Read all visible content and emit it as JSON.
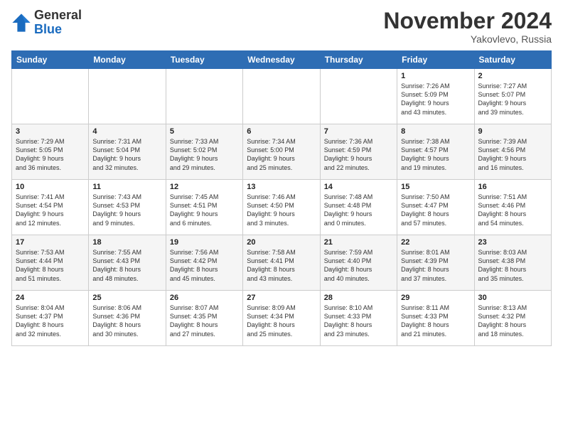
{
  "logo": {
    "line1": "General",
    "line2": "Blue"
  },
  "title": "November 2024",
  "location": "Yakovlevo, Russia",
  "weekdays": [
    "Sunday",
    "Monday",
    "Tuesday",
    "Wednesday",
    "Thursday",
    "Friday",
    "Saturday"
  ],
  "weeks": [
    [
      {
        "day": "",
        "info": ""
      },
      {
        "day": "",
        "info": ""
      },
      {
        "day": "",
        "info": ""
      },
      {
        "day": "",
        "info": ""
      },
      {
        "day": "",
        "info": ""
      },
      {
        "day": "1",
        "info": "Sunrise: 7:26 AM\nSunset: 5:09 PM\nDaylight: 9 hours\nand 43 minutes."
      },
      {
        "day": "2",
        "info": "Sunrise: 7:27 AM\nSunset: 5:07 PM\nDaylight: 9 hours\nand 39 minutes."
      }
    ],
    [
      {
        "day": "3",
        "info": "Sunrise: 7:29 AM\nSunset: 5:05 PM\nDaylight: 9 hours\nand 36 minutes."
      },
      {
        "day": "4",
        "info": "Sunrise: 7:31 AM\nSunset: 5:04 PM\nDaylight: 9 hours\nand 32 minutes."
      },
      {
        "day": "5",
        "info": "Sunrise: 7:33 AM\nSunset: 5:02 PM\nDaylight: 9 hours\nand 29 minutes."
      },
      {
        "day": "6",
        "info": "Sunrise: 7:34 AM\nSunset: 5:00 PM\nDaylight: 9 hours\nand 25 minutes."
      },
      {
        "day": "7",
        "info": "Sunrise: 7:36 AM\nSunset: 4:59 PM\nDaylight: 9 hours\nand 22 minutes."
      },
      {
        "day": "8",
        "info": "Sunrise: 7:38 AM\nSunset: 4:57 PM\nDaylight: 9 hours\nand 19 minutes."
      },
      {
        "day": "9",
        "info": "Sunrise: 7:39 AM\nSunset: 4:56 PM\nDaylight: 9 hours\nand 16 minutes."
      }
    ],
    [
      {
        "day": "10",
        "info": "Sunrise: 7:41 AM\nSunset: 4:54 PM\nDaylight: 9 hours\nand 12 minutes."
      },
      {
        "day": "11",
        "info": "Sunrise: 7:43 AM\nSunset: 4:53 PM\nDaylight: 9 hours\nand 9 minutes."
      },
      {
        "day": "12",
        "info": "Sunrise: 7:45 AM\nSunset: 4:51 PM\nDaylight: 9 hours\nand 6 minutes."
      },
      {
        "day": "13",
        "info": "Sunrise: 7:46 AM\nSunset: 4:50 PM\nDaylight: 9 hours\nand 3 minutes."
      },
      {
        "day": "14",
        "info": "Sunrise: 7:48 AM\nSunset: 4:48 PM\nDaylight: 9 hours\nand 0 minutes."
      },
      {
        "day": "15",
        "info": "Sunrise: 7:50 AM\nSunset: 4:47 PM\nDaylight: 8 hours\nand 57 minutes."
      },
      {
        "day": "16",
        "info": "Sunrise: 7:51 AM\nSunset: 4:46 PM\nDaylight: 8 hours\nand 54 minutes."
      }
    ],
    [
      {
        "day": "17",
        "info": "Sunrise: 7:53 AM\nSunset: 4:44 PM\nDaylight: 8 hours\nand 51 minutes."
      },
      {
        "day": "18",
        "info": "Sunrise: 7:55 AM\nSunset: 4:43 PM\nDaylight: 8 hours\nand 48 minutes."
      },
      {
        "day": "19",
        "info": "Sunrise: 7:56 AM\nSunset: 4:42 PM\nDaylight: 8 hours\nand 45 minutes."
      },
      {
        "day": "20",
        "info": "Sunrise: 7:58 AM\nSunset: 4:41 PM\nDaylight: 8 hours\nand 43 minutes."
      },
      {
        "day": "21",
        "info": "Sunrise: 7:59 AM\nSunset: 4:40 PM\nDaylight: 8 hours\nand 40 minutes."
      },
      {
        "day": "22",
        "info": "Sunrise: 8:01 AM\nSunset: 4:39 PM\nDaylight: 8 hours\nand 37 minutes."
      },
      {
        "day": "23",
        "info": "Sunrise: 8:03 AM\nSunset: 4:38 PM\nDaylight: 8 hours\nand 35 minutes."
      }
    ],
    [
      {
        "day": "24",
        "info": "Sunrise: 8:04 AM\nSunset: 4:37 PM\nDaylight: 8 hours\nand 32 minutes."
      },
      {
        "day": "25",
        "info": "Sunrise: 8:06 AM\nSunset: 4:36 PM\nDaylight: 8 hours\nand 30 minutes."
      },
      {
        "day": "26",
        "info": "Sunrise: 8:07 AM\nSunset: 4:35 PM\nDaylight: 8 hours\nand 27 minutes."
      },
      {
        "day": "27",
        "info": "Sunrise: 8:09 AM\nSunset: 4:34 PM\nDaylight: 8 hours\nand 25 minutes."
      },
      {
        "day": "28",
        "info": "Sunrise: 8:10 AM\nSunset: 4:33 PM\nDaylight: 8 hours\nand 23 minutes."
      },
      {
        "day": "29",
        "info": "Sunrise: 8:11 AM\nSunset: 4:33 PM\nDaylight: 8 hours\nand 21 minutes."
      },
      {
        "day": "30",
        "info": "Sunrise: 8:13 AM\nSunset: 4:32 PM\nDaylight: 8 hours\nand 18 minutes."
      }
    ]
  ]
}
